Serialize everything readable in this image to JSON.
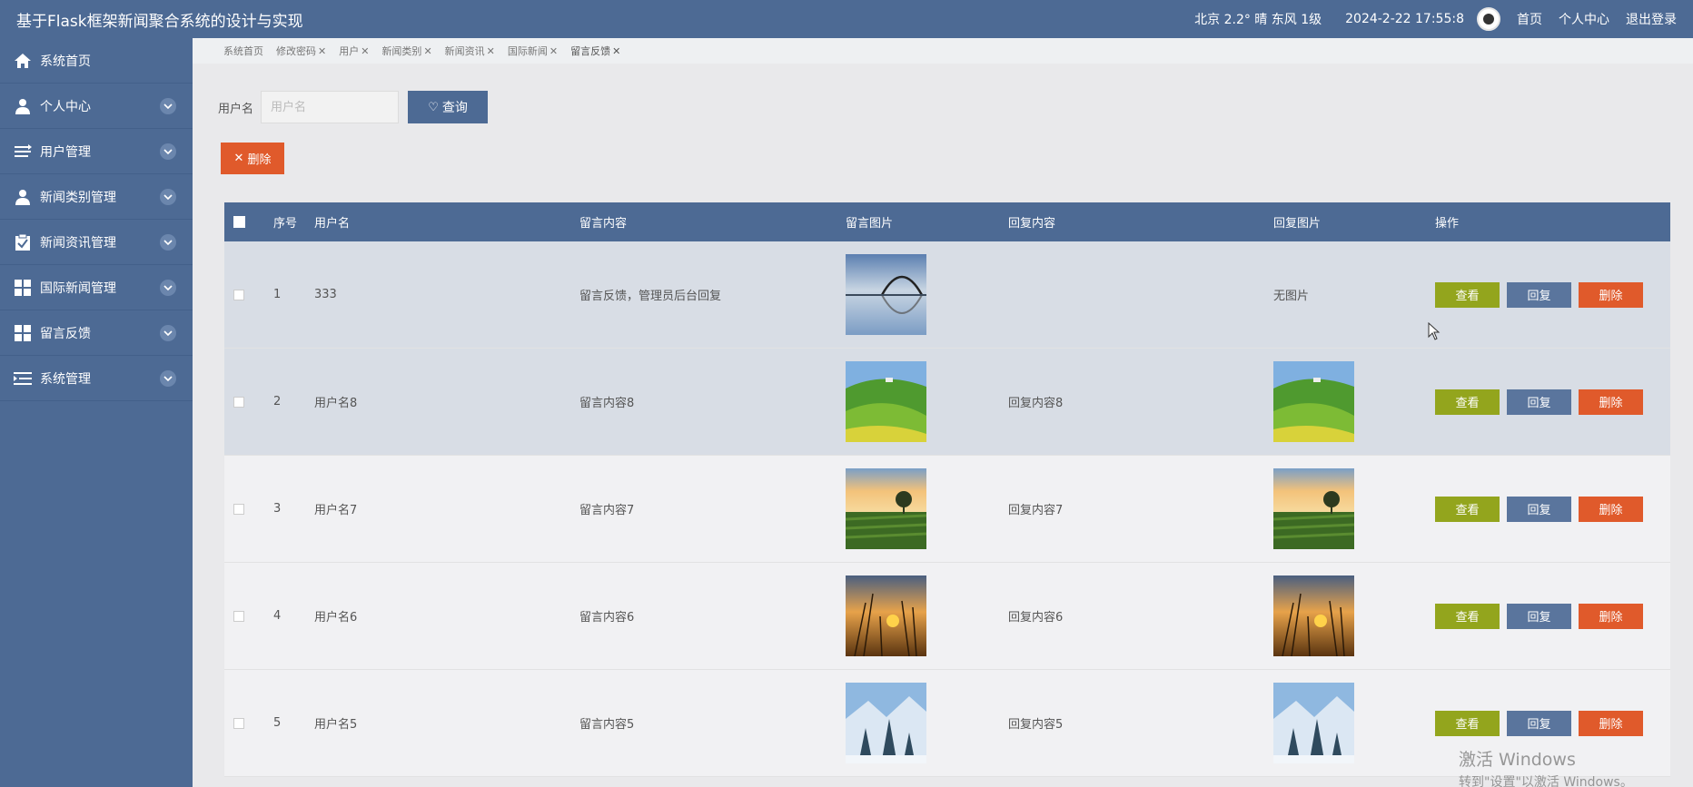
{
  "header": {
    "title": "基于Flask框架新闻聚合系统的设计与实现",
    "weather": "北京  2.2°  晴  东风  1级",
    "datetime": "2024-2-22 17:55:8",
    "links": [
      "首页",
      "个人中心",
      "退出登录"
    ]
  },
  "sidebar": {
    "items": [
      {
        "label": "系统首页",
        "icon": "home-icon",
        "expandable": false
      },
      {
        "label": "个人中心",
        "icon": "user-icon",
        "expandable": true
      },
      {
        "label": "用户管理",
        "icon": "list-icon",
        "expandable": true
      },
      {
        "label": "新闻类别管理",
        "icon": "user-icon",
        "expandable": true
      },
      {
        "label": "新闻资讯管理",
        "icon": "clipboard-icon",
        "expandable": true
      },
      {
        "label": "国际新闻管理",
        "icon": "grid-icon",
        "expandable": true
      },
      {
        "label": "留言反馈",
        "icon": "grid-icon",
        "expandable": true
      },
      {
        "label": "系统管理",
        "icon": "menu-icon",
        "expandable": true
      }
    ]
  },
  "tabs": [
    {
      "label": "系统首页",
      "closable": false,
      "active": false
    },
    {
      "label": "修改密码",
      "closable": true,
      "active": false
    },
    {
      "label": "用户",
      "closable": true,
      "active": false
    },
    {
      "label": "新闻类别",
      "closable": true,
      "active": false
    },
    {
      "label": "新闻资讯",
      "closable": true,
      "active": false
    },
    {
      "label": "国际新闻",
      "closable": true,
      "active": false
    },
    {
      "label": "留言反馈",
      "closable": true,
      "active": true
    }
  ],
  "search": {
    "label": "用户名",
    "placeholder": "用户名",
    "value": "",
    "button": "查询"
  },
  "actions": {
    "delete": "删除"
  },
  "table": {
    "headers": [
      "序号",
      "用户名",
      "留言内容",
      "留言图片",
      "回复内容",
      "回复图片",
      "操作"
    ],
    "rows": [
      {
        "no": "1",
        "user": "333",
        "content": "留言反馈，管理员后台回复",
        "img": "bridge",
        "reply": "",
        "reply_img": "none",
        "reply_img_text": "无图片"
      },
      {
        "no": "2",
        "user": "用户名8",
        "content": "留言内容8",
        "img": "hills",
        "reply": "回复内容8",
        "reply_img": "hills",
        "reply_img_text": ""
      },
      {
        "no": "3",
        "user": "用户名7",
        "content": "留言内容7",
        "img": "tea",
        "reply": "回复内容7",
        "reply_img": "tea",
        "reply_img_text": ""
      },
      {
        "no": "4",
        "user": "用户名6",
        "content": "留言内容6",
        "img": "sunset",
        "reply": "回复内容6",
        "reply_img": "sunset",
        "reply_img_text": ""
      },
      {
        "no": "5",
        "user": "用户名5",
        "content": "留言内容5",
        "img": "snow",
        "reply": "回复内容5",
        "reply_img": "snow",
        "reply_img_text": ""
      }
    ],
    "row_buttons": {
      "view": "查看",
      "reply": "回复",
      "delete": "删除"
    }
  },
  "watermark": {
    "line1": "激活 Windows",
    "line2": "转到\"设置\"以激活 Windows。"
  },
  "colors": {
    "primary": "#4d6a94",
    "view": "#93a51d",
    "reply": "#5a759d",
    "danger": "#e05a2b"
  }
}
